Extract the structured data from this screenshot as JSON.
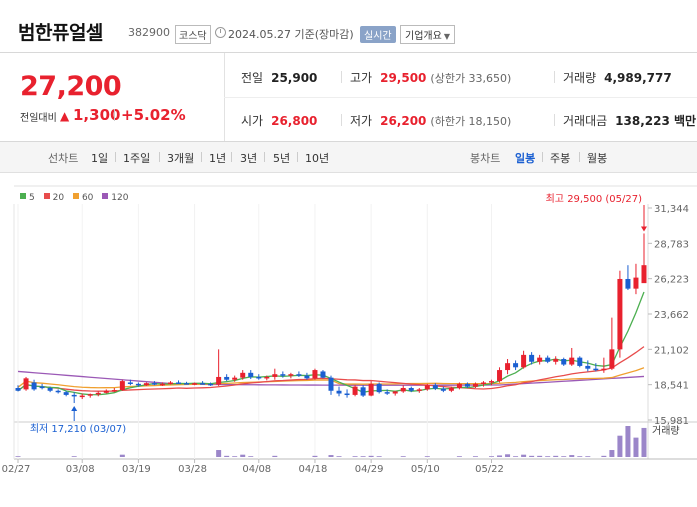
{
  "header": {
    "name": "범한퓨얼셀",
    "code": "382900",
    "market": "코스닥",
    "date": "2024.05.27 기준(장마감)",
    "realtime": "실시간",
    "company_info": "기업개요"
  },
  "quote": {
    "price": "27,200",
    "change_label": "전일대비",
    "change_arrow": "▲",
    "change": "1,300",
    "change_pct": "+5.02%",
    "rows": {
      "prev_label": "전일",
      "prev": "25,900",
      "high_label": "고가",
      "high": "29,500",
      "upper_limit": "(상한가 33,650)",
      "volume_label": "거래량",
      "volume": "4,989,777",
      "open_label": "시가",
      "open": "26,800",
      "low_label": "저가",
      "low": "26,200",
      "lower_limit": "(하한가 18,150)",
      "amount_label": "거래대금",
      "amount": "138,223 백만"
    }
  },
  "period_bar": {
    "line_title": "선차트",
    "line_items": [
      "1일",
      "1주일",
      "3개월",
      "1년",
      "3년",
      "5년",
      "10년"
    ],
    "candle_title": "봉차트",
    "candle_items": [
      "일봉",
      "주봉",
      "월봉"
    ],
    "candle_active": "일봉"
  },
  "colors": {
    "up": "#e8212e",
    "down": "#1a5fd1",
    "ma5": "#4caf50",
    "ma20": "#e84c4c",
    "ma60": "#f0a030",
    "ma120": "#9b59b6",
    "volume": "#9b86c9"
  },
  "chart_data": {
    "type": "candlestick",
    "legend": [
      {
        "name": "5",
        "color": "#4caf50"
      },
      {
        "name": "20",
        "color": "#e84c4c"
      },
      {
        "name": "60",
        "color": "#f0a030"
      },
      {
        "name": "120",
        "color": "#9b59b6"
      }
    ],
    "y_ticks": [
      "31,344",
      "28,783",
      "26,223",
      "23,662",
      "21,102",
      "18,541",
      "15,981"
    ],
    "ylim": [
      15981,
      31344
    ],
    "x_ticks": [
      "02/27",
      "03/08",
      "03/19",
      "03/28",
      "04/08",
      "04/18",
      "04/29",
      "05/10",
      "05/22"
    ],
    "high_annotation": "최고 29,500 (05/27)",
    "low_annotation": "최저 17,210 (03/07)",
    "volume_label": "거래량",
    "candles": [
      {
        "o": 18300,
        "h": 18500,
        "l": 18050,
        "c": 18100
      },
      {
        "o": 18200,
        "h": 19100,
        "l": 18100,
        "c": 19000
      },
      {
        "o": 18700,
        "h": 18900,
        "l": 18100,
        "c": 18200
      },
      {
        "o": 18400,
        "h": 18600,
        "l": 18200,
        "c": 18300
      },
      {
        "o": 18300,
        "h": 18400,
        "l": 18000,
        "c": 18100
      },
      {
        "o": 18100,
        "h": 18200,
        "l": 17900,
        "c": 18000
      },
      {
        "o": 18000,
        "h": 18100,
        "l": 17700,
        "c": 17800
      },
      {
        "o": 17800,
        "h": 18000,
        "l": 17210,
        "c": 17700
      },
      {
        "o": 17700,
        "h": 17900,
        "l": 17500,
        "c": 17750
      },
      {
        "o": 17750,
        "h": 17900,
        "l": 17600,
        "c": 17850
      },
      {
        "o": 17850,
        "h": 18050,
        "l": 17700,
        "c": 17950
      },
      {
        "o": 17950,
        "h": 18200,
        "l": 17900,
        "c": 18100
      },
      {
        "o": 18100,
        "h": 18300,
        "l": 18000,
        "c": 18150
      },
      {
        "o": 18150,
        "h": 18900,
        "l": 18100,
        "c": 18800
      },
      {
        "o": 18700,
        "h": 18900,
        "l": 18500,
        "c": 18600
      },
      {
        "o": 18600,
        "h": 18700,
        "l": 18400,
        "c": 18500
      },
      {
        "o": 18500,
        "h": 18700,
        "l": 18450,
        "c": 18650
      },
      {
        "o": 18650,
        "h": 18800,
        "l": 18500,
        "c": 18550
      },
      {
        "o": 18550,
        "h": 18700,
        "l": 18450,
        "c": 18600
      },
      {
        "o": 18600,
        "h": 18800,
        "l": 18550,
        "c": 18700
      },
      {
        "o": 18700,
        "h": 18850,
        "l": 18600,
        "c": 18650
      },
      {
        "o": 18650,
        "h": 18750,
        "l": 18550,
        "c": 18600
      },
      {
        "o": 18600,
        "h": 18700,
        "l": 18500,
        "c": 18650
      },
      {
        "o": 18650,
        "h": 18800,
        "l": 18550,
        "c": 18600
      },
      {
        "o": 18600,
        "h": 18700,
        "l": 18450,
        "c": 18550
      },
      {
        "o": 18550,
        "h": 21100,
        "l": 18450,
        "c": 19100
      },
      {
        "o": 19100,
        "h": 19300,
        "l": 18800,
        "c": 18900
      },
      {
        "o": 18900,
        "h": 19200,
        "l": 18750,
        "c": 19050
      },
      {
        "o": 19050,
        "h": 19600,
        "l": 18900,
        "c": 19400
      },
      {
        "o": 19400,
        "h": 19600,
        "l": 18950,
        "c": 19100
      },
      {
        "o": 19100,
        "h": 19300,
        "l": 18900,
        "c": 19000
      },
      {
        "o": 19000,
        "h": 19200,
        "l": 18850,
        "c": 19100
      },
      {
        "o": 19100,
        "h": 19700,
        "l": 18900,
        "c": 19300
      },
      {
        "o": 19300,
        "h": 19500,
        "l": 19050,
        "c": 19200
      },
      {
        "o": 19200,
        "h": 19400,
        "l": 19000,
        "c": 19300
      },
      {
        "o": 19300,
        "h": 19500,
        "l": 19100,
        "c": 19200
      },
      {
        "o": 19200,
        "h": 19400,
        "l": 18900,
        "c": 19000
      },
      {
        "o": 19000,
        "h": 19700,
        "l": 18900,
        "c": 19600
      },
      {
        "o": 19500,
        "h": 19600,
        "l": 19000,
        "c": 19050
      },
      {
        "o": 19050,
        "h": 19200,
        "l": 17800,
        "c": 18100
      },
      {
        "o": 18100,
        "h": 18400,
        "l": 17700,
        "c": 17900
      },
      {
        "o": 17900,
        "h": 18200,
        "l": 17600,
        "c": 17800
      },
      {
        "o": 17800,
        "h": 18500,
        "l": 17700,
        "c": 18400
      },
      {
        "o": 18350,
        "h": 18500,
        "l": 17650,
        "c": 17750
      },
      {
        "o": 17750,
        "h": 18800,
        "l": 17700,
        "c": 18600
      },
      {
        "o": 18600,
        "h": 18700,
        "l": 17900,
        "c": 18000
      },
      {
        "o": 18000,
        "h": 18200,
        "l": 17800,
        "c": 17900
      },
      {
        "o": 17900,
        "h": 18100,
        "l": 17750,
        "c": 18050
      },
      {
        "o": 18050,
        "h": 18500,
        "l": 17950,
        "c": 18300
      },
      {
        "o": 18300,
        "h": 18400,
        "l": 18000,
        "c": 18100
      },
      {
        "o": 18100,
        "h": 18300,
        "l": 17950,
        "c": 18200
      },
      {
        "o": 18200,
        "h": 18600,
        "l": 18100,
        "c": 18500
      },
      {
        "o": 18500,
        "h": 18650,
        "l": 18150,
        "c": 18250
      },
      {
        "o": 18250,
        "h": 18400,
        "l": 18000,
        "c": 18100
      },
      {
        "o": 18100,
        "h": 18400,
        "l": 18000,
        "c": 18300
      },
      {
        "o": 18300,
        "h": 18700,
        "l": 18200,
        "c": 18600
      },
      {
        "o": 18600,
        "h": 18700,
        "l": 18300,
        "c": 18400
      },
      {
        "o": 18400,
        "h": 18700,
        "l": 18300,
        "c": 18600
      },
      {
        "o": 18600,
        "h": 18800,
        "l": 18400,
        "c": 18700
      },
      {
        "o": 18700,
        "h": 18900,
        "l": 18500,
        "c": 18800
      },
      {
        "o": 18800,
        "h": 19800,
        "l": 18700,
        "c": 19600
      },
      {
        "o": 19600,
        "h": 20400,
        "l": 19300,
        "c": 20100
      },
      {
        "o": 20100,
        "h": 20300,
        "l": 19600,
        "c": 19800
      },
      {
        "o": 19800,
        "h": 21000,
        "l": 19700,
        "c": 20700
      },
      {
        "o": 20700,
        "h": 20900,
        "l": 20000,
        "c": 20200
      },
      {
        "o": 20200,
        "h": 20700,
        "l": 20000,
        "c": 20500
      },
      {
        "o": 20500,
        "h": 20650,
        "l": 20100,
        "c": 20200
      },
      {
        "o": 20200,
        "h": 20600,
        "l": 20000,
        "c": 20400
      },
      {
        "o": 20400,
        "h": 20500,
        "l": 19900,
        "c": 20000
      },
      {
        "o": 20000,
        "h": 21200,
        "l": 19900,
        "c": 20500
      },
      {
        "o": 20500,
        "h": 20600,
        "l": 19800,
        "c": 19900
      },
      {
        "o": 19900,
        "h": 20300,
        "l": 19500,
        "c": 19700
      },
      {
        "o": 19700,
        "h": 20100,
        "l": 19500,
        "c": 19600
      },
      {
        "o": 19600,
        "h": 20500,
        "l": 19400,
        "c": 19700
      },
      {
        "o": 19700,
        "h": 23400,
        "l": 19600,
        "c": 21100
      },
      {
        "o": 21100,
        "h": 26800,
        "l": 20500,
        "c": 26200
      },
      {
        "o": 26200,
        "h": 27200,
        "l": 25400,
        "c": 25500
      },
      {
        "o": 25500,
        "h": 27300,
        "l": 25100,
        "c": 26300
      },
      {
        "o": 25900,
        "h": 29500,
        "l": 26200,
        "c": 27200
      }
    ],
    "volumes": [
      2,
      1,
      1,
      1,
      1,
      1,
      1,
      2,
      1,
      1,
      1,
      1,
      1,
      6,
      1,
      1,
      1,
      1,
      1,
      1,
      1,
      1,
      1,
      1,
      1,
      18,
      3,
      2,
      6,
      2,
      1,
      1,
      3,
      1,
      1,
      1,
      1,
      3,
      1,
      5,
      2,
      1,
      2,
      2,
      3,
      2,
      1,
      1,
      2,
      1,
      1,
      2,
      1,
      1,
      1,
      2,
      1,
      2,
      1,
      2,
      4,
      7,
      2,
      6,
      3,
      3,
      2,
      3,
      2,
      5,
      2,
      2,
      1,
      3,
      18,
      55,
      80,
      50,
      75
    ]
  }
}
